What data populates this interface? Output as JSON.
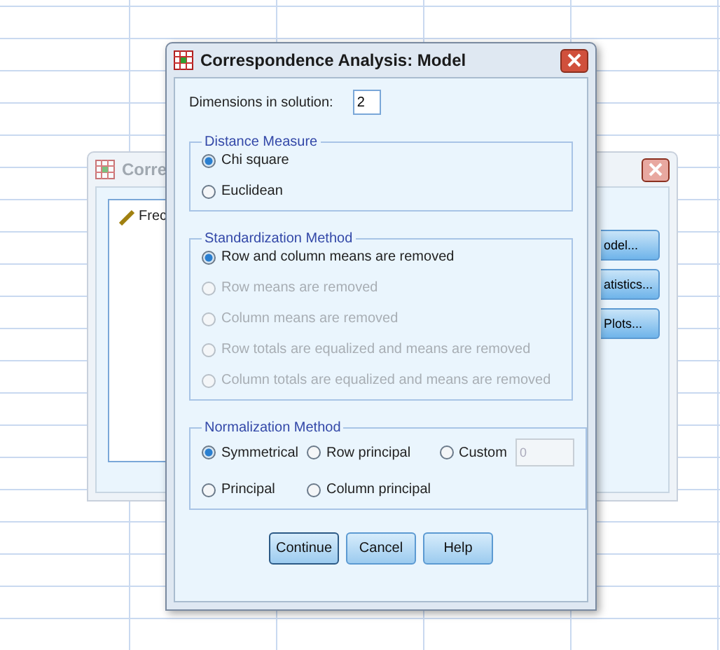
{
  "back_window": {
    "title": "Corre",
    "list_item": "Frec",
    "buttons": [
      "odel...",
      "atistics...",
      "Plots..."
    ]
  },
  "dialog": {
    "title": "Correspondence Analysis: Model",
    "dimensions": {
      "label": "Dimensions in solution:",
      "value": "2"
    },
    "distance_measure": {
      "title": "Distance Measure",
      "options": [
        {
          "label": "Chi square",
          "selected": true
        },
        {
          "label": "Euclidean",
          "selected": false
        }
      ]
    },
    "standardization_method": {
      "title": "Standardization Method",
      "options": [
        {
          "label": "Row and column means are removed",
          "selected": true,
          "disabled": false
        },
        {
          "label": "Row means are removed",
          "selected": false,
          "disabled": true
        },
        {
          "label": "Column means are removed",
          "selected": false,
          "disabled": true
        },
        {
          "label": "Row totals are equalized and means are removed",
          "selected": false,
          "disabled": true
        },
        {
          "label": "Column totals are equalized and means are removed",
          "selected": false,
          "disabled": true
        }
      ]
    },
    "normalization_method": {
      "title": "Normalization Method",
      "options": [
        {
          "label": "Symmetrical",
          "selected": true
        },
        {
          "label": "Row principal",
          "selected": false
        },
        {
          "label": "Custom",
          "selected": false
        },
        {
          "label": "Principal",
          "selected": false
        },
        {
          "label": "Column principal",
          "selected": false
        }
      ],
      "custom_value": {
        "value": "0",
        "disabled": true
      }
    },
    "buttons": [
      {
        "label": "Continue",
        "default": true
      },
      {
        "label": "Cancel",
        "default": false
      },
      {
        "label": "Help",
        "default": false
      }
    ]
  }
}
